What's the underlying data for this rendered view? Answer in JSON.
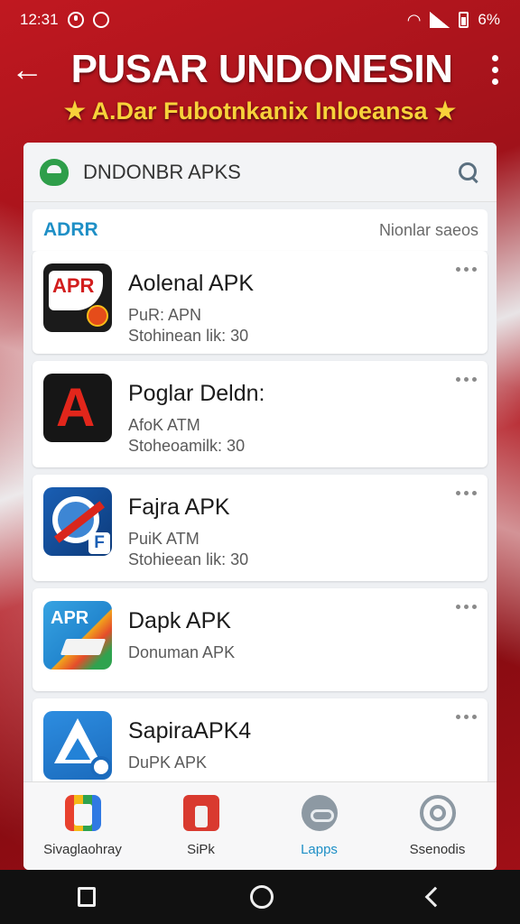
{
  "status_bar": {
    "time": "12:31",
    "battery": "6%"
  },
  "header": {
    "title": "PUSAR UNDONESIN",
    "subtitle": "★ A.Dar Fubotnkanix Inloeansa ★"
  },
  "search": {
    "placeholder": "DNDONBR APKS"
  },
  "section": {
    "title": "ADRR",
    "link": "Nionlar saeos"
  },
  "apps": [
    {
      "name": "Aolenal APK",
      "line1": "PuR: APN",
      "line2": "Stohinean lik: 30",
      "icon": "apk-red-icon"
    },
    {
      "name": "Poglar Deldn:",
      "line1": "AfoK ATM",
      "line2": "Stoheoamilk: 30",
      "icon": "red-a-icon"
    },
    {
      "name": "Fajra APK",
      "line1": "PuiK ATM",
      "line2": "Stohieean lik: 30",
      "icon": "blue-compass-icon"
    },
    {
      "name": "Dapk APK",
      "line1": "Donuman APK",
      "line2": "",
      "icon": "apr-colorful-icon"
    },
    {
      "name": "SapiraAPK4",
      "line1": "DuPK APK",
      "line2": "",
      "icon": "blue-triangle-icon"
    }
  ],
  "bottom_nav": [
    {
      "label": "Sivaglaohray",
      "icon": "grid-multicolor-icon"
    },
    {
      "label": "SiPk",
      "icon": "red-apk-icon"
    },
    {
      "label": "Lapps",
      "icon": "face-circle-icon"
    },
    {
      "label": "Ssenodis",
      "icon": "settings-ring-icon"
    }
  ],
  "colors": {
    "accent": "#1e8fc6",
    "header_bg": "#a0121a",
    "subtitle": "#f7d23a"
  }
}
